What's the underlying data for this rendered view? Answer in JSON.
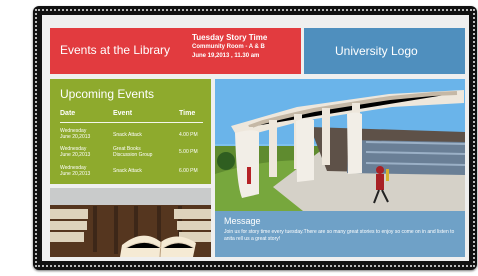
{
  "sign": {
    "title": "Events at the Library",
    "story": {
      "title": "Tuesday Story Time",
      "location": "Community Room - A & B",
      "datetime": "June 19,2013 , 11.30 am"
    },
    "logo": {
      "label": "University Logo"
    },
    "upcoming": {
      "heading": "Upcoming Events",
      "headers": {
        "date": "Date",
        "event": "Event",
        "time": "Time"
      },
      "rows": [
        {
          "date_line1": "Wednesday",
          "date_line2": "June 20,2013",
          "event_line1": "Snack Attack",
          "event_line2": "",
          "time": "4.00 PM"
        },
        {
          "date_line1": "Wednesday",
          "date_line2": "June 20,2013",
          "event_line1": "Great Books",
          "event_line2": "Discussion Group",
          "time": "5.00 PM"
        },
        {
          "date_line1": "Wednesday",
          "date_line2": "June 20,2013",
          "event_line1": "Snack Attack",
          "event_line2": "",
          "time": "6.00 PM"
        }
      ]
    },
    "message": {
      "title": "Message",
      "body": "Join us for story time every tuesday.There are so many great stories to enjoy so come on in and listen to anita rell us a great story!"
    }
  },
  "colors": {
    "frame": "#111111",
    "red_panel": "#e23b3f",
    "blue_panel": "#4f8fbe",
    "green_panel": "#8eaa2d",
    "message_panel": "#6fa1c7",
    "text": "#ffffff"
  },
  "icons": {
    "campus_photo": "campus-photo-icon",
    "library_photo": "library-photo-icon"
  }
}
